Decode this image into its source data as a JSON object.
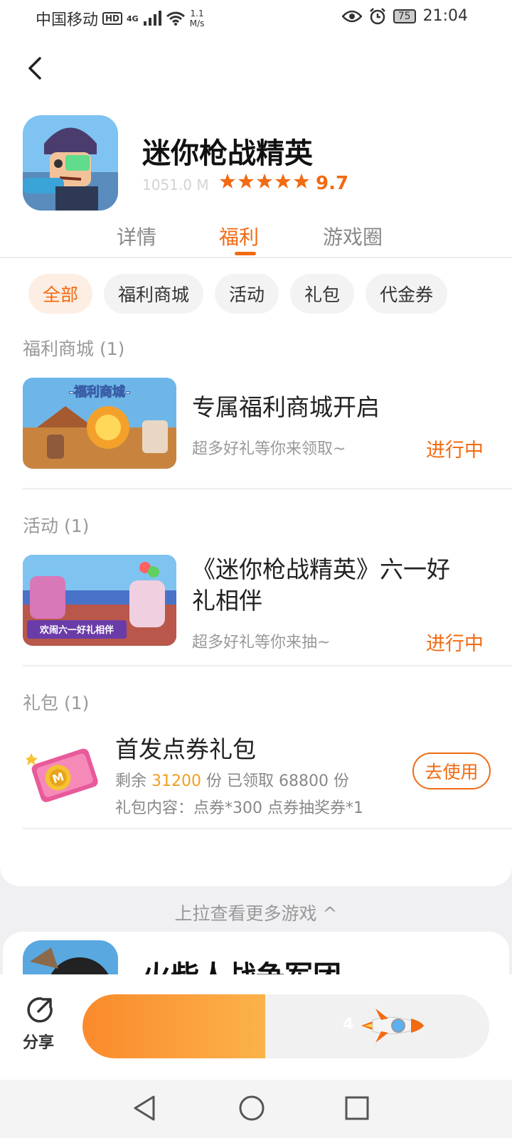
{
  "status_bar": {
    "carrier": "中国移动",
    "hd": "HD",
    "network": "4G",
    "speed_value": "1.1",
    "speed_unit": "M/s",
    "battery": "75",
    "time": "21:04"
  },
  "app": {
    "title": "迷你枪战精英",
    "size": "1051.0 M",
    "rating": "9.7",
    "stars": 5
  },
  "tabs": [
    {
      "label": "详情",
      "active": false
    },
    {
      "label": "福利",
      "active": true
    },
    {
      "label": "游戏圈",
      "active": false
    }
  ],
  "filters": [
    {
      "label": "全部",
      "active": true
    },
    {
      "label": "福利商城",
      "active": false
    },
    {
      "label": "活动",
      "active": false
    },
    {
      "label": "礼包",
      "active": false
    },
    {
      "label": "代金券",
      "active": false
    }
  ],
  "sections": {
    "mall": {
      "header": "福利商城 (1)",
      "thumb_caption": "-福利商城-",
      "title": "专属福利商城开启",
      "desc": "超多好礼等你来领取~",
      "status": "进行中"
    },
    "activity": {
      "header": "活动 (1)",
      "thumb_caption": "欢闹六一好礼相伴",
      "title_line1": "《迷你枪战精英》六一好",
      "title_line2": "礼相伴",
      "desc": "超多好礼等你来抽~",
      "status": "进行中"
    },
    "gift": {
      "header": "礼包 (1)",
      "title": "首发点券礼包",
      "remain_prefix": "剩余",
      "remain_count": "31200",
      "remain_mid": "份 已领取",
      "claimed_count": "68800",
      "remain_suffix": "份",
      "content": "礼包内容：点券*300 点券抽奖券*1",
      "button": "去使用"
    }
  },
  "pull_more": "上拉查看更多游戏 ^",
  "next_game": {
    "title": "火柴人战争军团"
  },
  "bottom_bar": {
    "share_label": "分享",
    "progress_text": "4",
    "progress_fraction": 0.45
  },
  "colors": {
    "accent": "#f26a12",
    "highlight": "#f0a020"
  }
}
